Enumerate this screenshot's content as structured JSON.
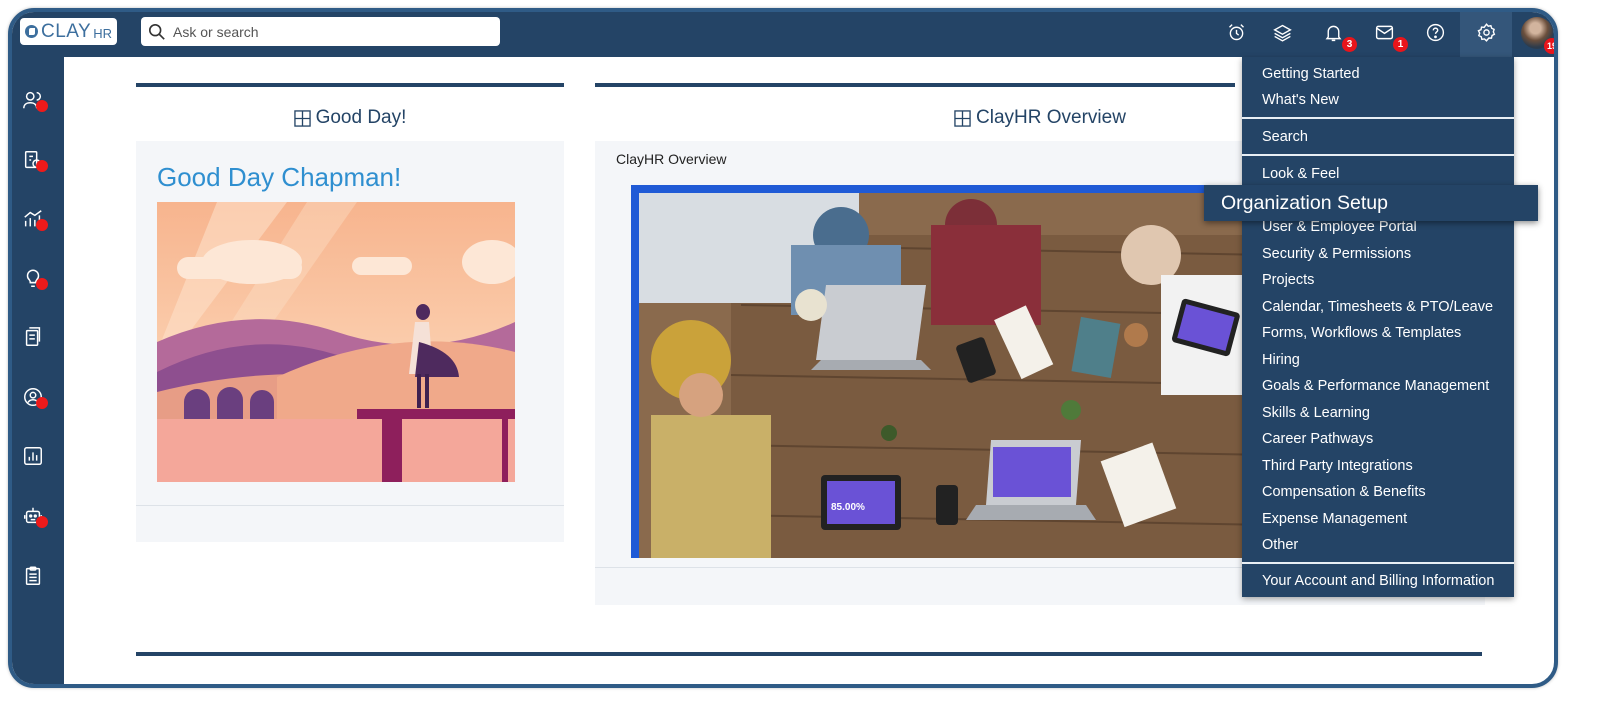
{
  "brand": {
    "clay": "CLAY",
    "hr": "HR"
  },
  "search": {
    "placeholder": "Ask or search"
  },
  "header": {
    "notifications_count": "3",
    "messages_count": "1",
    "avatar_badge": "19"
  },
  "cards": {
    "good_day": {
      "title": "Good Day!",
      "greeting": "Good Day Chapman!"
    },
    "overview": {
      "title": "ClayHR Overview",
      "label": "ClayHR Overview",
      "video_stat": "85.00%"
    }
  },
  "settings_menu": {
    "hovered": "Organization Setup",
    "groups": [
      [
        "Getting Started",
        "What's New"
      ],
      [
        "Search"
      ],
      [
        "Look & Feel",
        "Organization Setup",
        "User & Employee Portal",
        "Security & Permissions",
        "Projects",
        "Calendar, Timesheets & PTO/Leave",
        "Forms, Workflows & Templates",
        "Hiring",
        "Goals & Performance Management",
        "Skills & Learning",
        "Career Pathways",
        "Third Party Integrations",
        "Compensation & Benefits",
        "Expense Management",
        "Other"
      ],
      [
        "Your Account and Billing Information"
      ]
    ]
  },
  "colors": {
    "navy": "#244466",
    "accent_blue": "#2f8fd0",
    "badge_red": "#e8151b",
    "card_bg": "#f4f6f9"
  }
}
